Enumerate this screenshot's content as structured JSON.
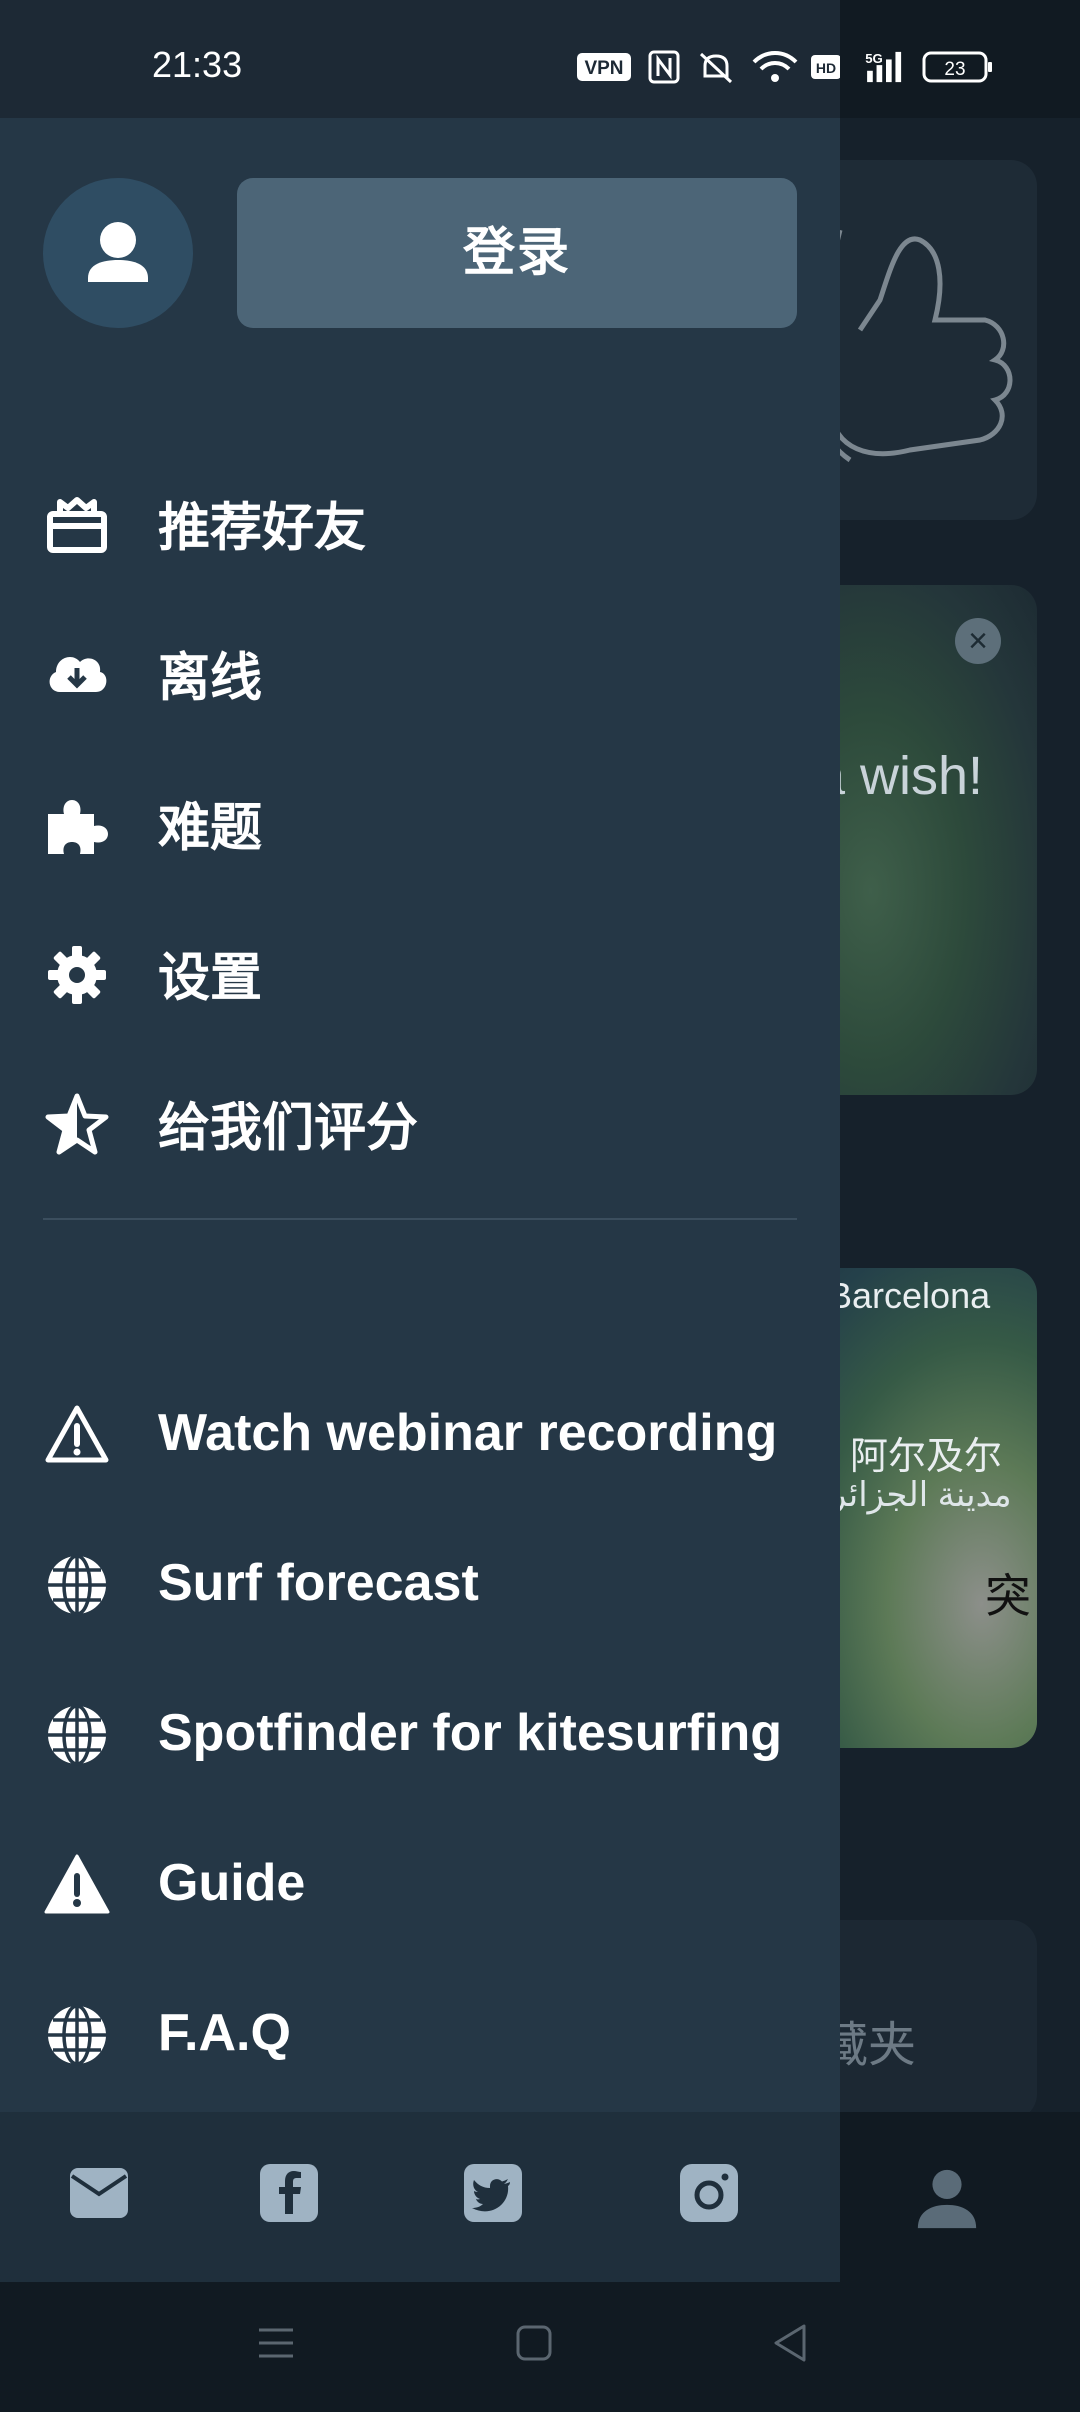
{
  "status_bar": {
    "time": "21:33",
    "vpn_label": "VPN",
    "hd_label": "HD",
    "network_label": "5G",
    "battery_label": "23"
  },
  "background": {
    "card2_text": "a wish!",
    "map_label_city": "Barcelona",
    "map_label_country": "阿尔及尔",
    "map_label_arabic": "مدينة الجزائر",
    "map_label_partial": "突",
    "card4_text": "藏夹"
  },
  "drawer": {
    "login_label": "登录",
    "menu_primary": [
      {
        "label": "推荐好友",
        "icon": "gift-icon"
      },
      {
        "label": "离线",
        "icon": "cloud-download-icon"
      },
      {
        "label": "难题",
        "icon": "puzzle-icon"
      },
      {
        "label": "设置",
        "icon": "gear-icon"
      },
      {
        "label": "给我们评分",
        "icon": "star-half-icon"
      }
    ],
    "menu_secondary": [
      {
        "label": "Watch webinar recording",
        "icon": "warning-outline-icon"
      },
      {
        "label": "Surf forecast",
        "icon": "globe-icon"
      },
      {
        "label": "Spotfinder for kitesurfing",
        "icon": "globe-icon"
      },
      {
        "label": "Guide",
        "icon": "warning-filled-icon"
      },
      {
        "label": "F.A.Q",
        "icon": "globe-icon"
      }
    ],
    "social": [
      "mail-icon",
      "facebook-icon",
      "twitter-icon",
      "instagram-icon"
    ]
  },
  "colors": {
    "drawer_bg": "#253746",
    "login_button": "#4c6577",
    "avatar_bg": "#2f4d63",
    "social_icon": "#9fb3c3"
  }
}
